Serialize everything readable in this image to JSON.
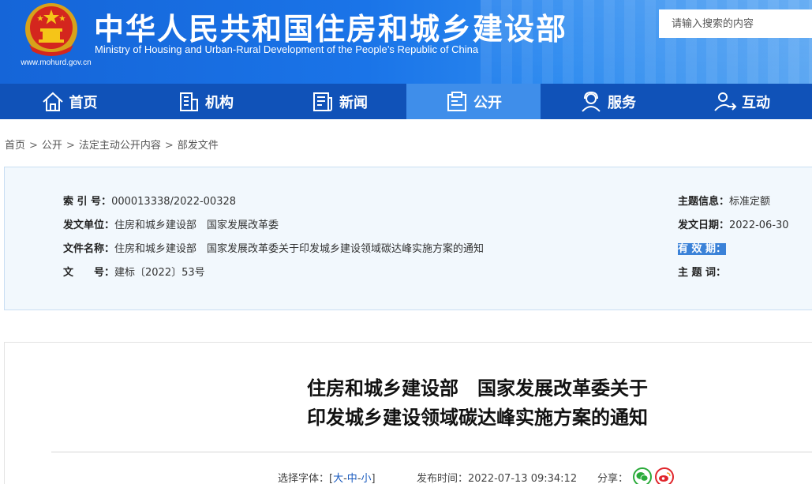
{
  "header": {
    "title": "中华人民共和国住房和城乡建设部",
    "subtitle": "Ministry of Housing and Urban-Rural Development of the People’s Republic of China",
    "url": "www.mohurd.gov.cn",
    "search_placeholder": "请输入搜索的内容"
  },
  "nav": {
    "items": [
      {
        "label": "首页",
        "icon": "home-icon"
      },
      {
        "label": "机构",
        "icon": "building-icon"
      },
      {
        "label": "新闻",
        "icon": "newspaper-icon"
      },
      {
        "label": "公开",
        "icon": "document-icon",
        "active": true
      },
      {
        "label": "服务",
        "icon": "service-person-icon"
      },
      {
        "label": "互动",
        "icon": "interaction-person-icon"
      }
    ]
  },
  "breadcrumb": {
    "items": [
      "首页",
      "公开",
      "法定主动公开内容",
      "部发文件"
    ],
    "separator": ">"
  },
  "info": {
    "index_label": "索 引 号：",
    "index_value": "000013338/2022-00328",
    "issuer_label": "发文单位：",
    "issuer_value": "住房和城乡建设部　国家发展改革委",
    "docname_label": "文件名称：",
    "docname_value": "住房和城乡建设部　国家发展改革委关于印发城乡建设领域碳达峰实施方案的通知",
    "docnum_label": "文　　号：",
    "docnum_value": "建标〔2022〕53号",
    "topic_label": "主题信息：",
    "topic_value": "标准定额",
    "date_label": "发文日期：",
    "date_value": "2022-06-30",
    "validity_label": "有 效 期：",
    "keywords_label": "主 题 词："
  },
  "article": {
    "title_line1": "住房和城乡建设部　国家发展改革委关于",
    "title_line2": "印发城乡建设领域碳达峰实施方案的通知",
    "font_label": "选择字体：[",
    "font_large": "大",
    "font_medium": "中",
    "font_small": "小",
    "font_dash": "-",
    "font_close": "]",
    "publish_label": "发布时间：",
    "publish_value": "2022-07-13 09:34:12",
    "share_label": "分享："
  },
  "colors": {
    "header_blue": "#1a74e8",
    "nav_blue": "#1052b8",
    "nav_active": "#3f8eea",
    "wechat_green": "#2bab3b",
    "weibo_red": "#e0262c"
  }
}
